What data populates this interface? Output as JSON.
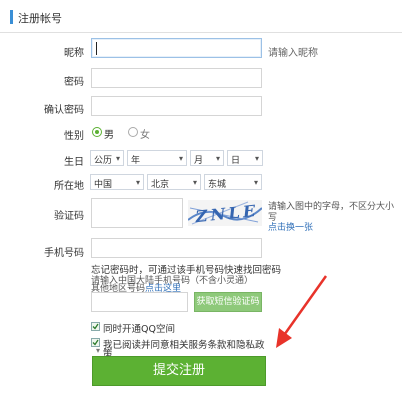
{
  "header": {
    "title": "注册帐号"
  },
  "form": {
    "nickname": {
      "label": "昵称",
      "value": "",
      "hint": "请输入昵称"
    },
    "password": {
      "label": "密码",
      "value": ""
    },
    "confirm_password": {
      "label": "确认密码",
      "value": ""
    },
    "gender": {
      "label": "性别",
      "options": [
        "男",
        "女"
      ],
      "selected": "男"
    },
    "birthday": {
      "label": "生日",
      "calendar": "公历",
      "year": "年",
      "month": "月",
      "day": "日"
    },
    "location": {
      "label": "所在地",
      "country": "中国",
      "province": "北京",
      "district": "东城"
    },
    "captcha": {
      "label": "验证码",
      "value": "",
      "image_text": "ZNLE",
      "hint_line1": "请输入图中的字母，不区分大小",
      "hint_line2": "写",
      "refresh_link": "点击换一张"
    },
    "phone": {
      "label": "手机号码",
      "value": ""
    },
    "phone_help_line1": "忘记密码时，可通过该手机号码快速找回密码",
    "phone_help_line2": "请输入中国大陆手机号码（不含小灵通）",
    "phone_help_line3_prefix": "其他地区号码",
    "phone_help_line3_link": "点击这里",
    "sms": {
      "value": "",
      "button_label": "获取短信验证码"
    },
    "options": {
      "open_qzone": {
        "label": "同时开通QQ空间",
        "checked": true
      },
      "agree": {
        "label_line1": "我已阅读并同意相关服务条款和隐私政",
        "label_line2": "策",
        "checked": true
      }
    },
    "submit_label": "提交注册"
  },
  "colors": {
    "accent": "#5cb133",
    "link": "#2f6fb8",
    "annotation_arrow": "#e8332a"
  }
}
